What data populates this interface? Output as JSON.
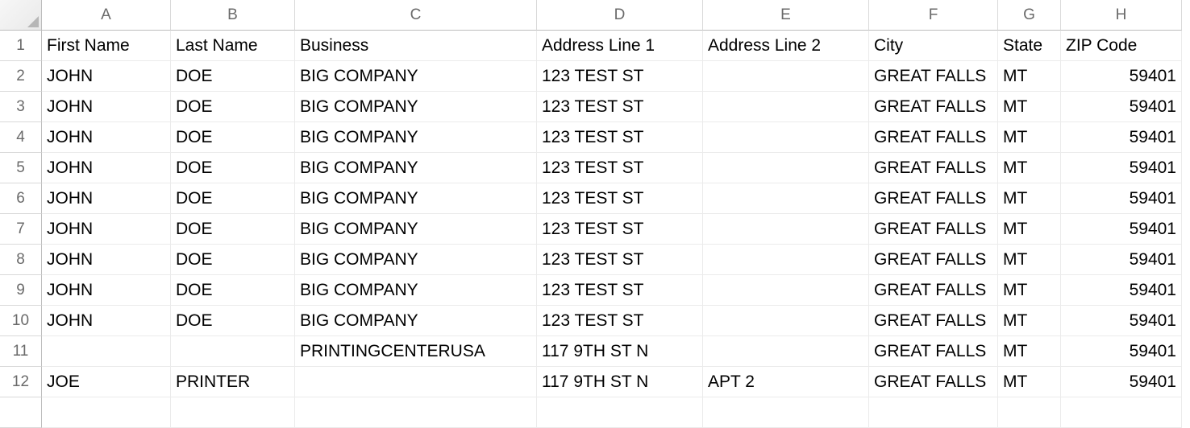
{
  "columns": [
    "A",
    "B",
    "C",
    "D",
    "E",
    "F",
    "G",
    "H"
  ],
  "row_numbers": [
    "1",
    "2",
    "3",
    "4",
    "5",
    "6",
    "7",
    "8",
    "9",
    "10",
    "11",
    "12",
    ""
  ],
  "headers": [
    "First Name",
    "Last Name",
    "Business",
    "Address Line 1",
    "Address Line 2",
    "City",
    "State",
    "ZIP Code"
  ],
  "numeric_cols": [
    7
  ],
  "rows": [
    [
      "JOHN",
      "DOE",
      "BIG COMPANY",
      "123 TEST ST",
      "",
      "GREAT FALLS",
      "MT",
      "59401"
    ],
    [
      "JOHN",
      "DOE",
      "BIG COMPANY",
      "123 TEST ST",
      "",
      "GREAT FALLS",
      "MT",
      "59401"
    ],
    [
      "JOHN",
      "DOE",
      "BIG COMPANY",
      "123 TEST ST",
      "",
      "GREAT FALLS",
      "MT",
      "59401"
    ],
    [
      "JOHN",
      "DOE",
      "BIG COMPANY",
      "123 TEST ST",
      "",
      "GREAT FALLS",
      "MT",
      "59401"
    ],
    [
      "JOHN",
      "DOE",
      "BIG COMPANY",
      "123 TEST ST",
      "",
      "GREAT FALLS",
      "MT",
      "59401"
    ],
    [
      "JOHN",
      "DOE",
      "BIG COMPANY",
      "123 TEST ST",
      "",
      "GREAT FALLS",
      "MT",
      "59401"
    ],
    [
      "JOHN",
      "DOE",
      "BIG COMPANY",
      "123 TEST ST",
      "",
      "GREAT FALLS",
      "MT",
      "59401"
    ],
    [
      "JOHN",
      "DOE",
      "BIG COMPANY",
      "123 TEST ST",
      "",
      "GREAT FALLS",
      "MT",
      "59401"
    ],
    [
      "JOHN",
      "DOE",
      "BIG COMPANY",
      "123 TEST ST",
      "",
      "GREAT FALLS",
      "MT",
      "59401"
    ],
    [
      "",
      "",
      "PRINTINGCENTERUSA",
      "117 9TH ST N",
      "",
      "GREAT FALLS",
      "MT",
      "59401"
    ],
    [
      "JOE",
      "PRINTER",
      "",
      "117 9TH ST N",
      "APT 2",
      "GREAT FALLS",
      "MT",
      "59401"
    ],
    [
      "",
      "",
      "",
      "",
      "",
      "",
      "",
      ""
    ]
  ]
}
